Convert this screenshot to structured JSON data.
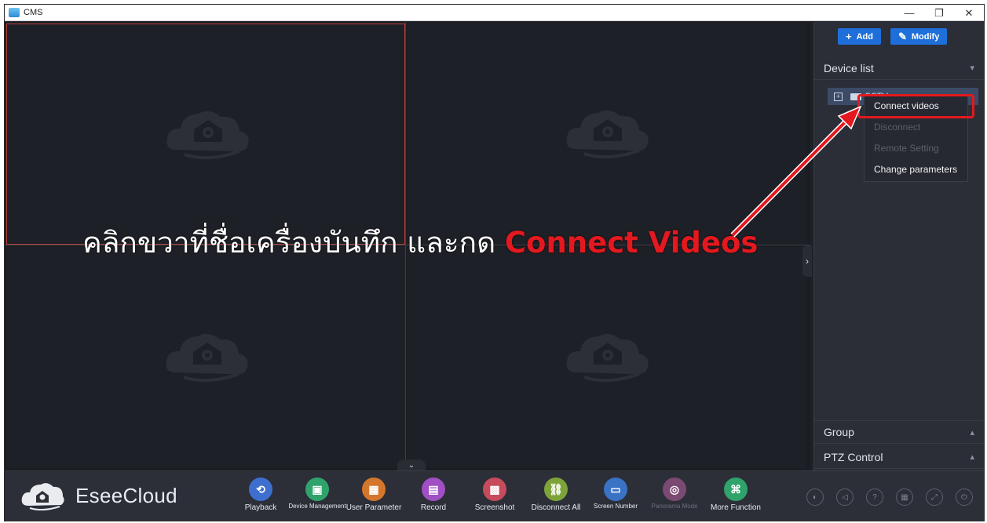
{
  "window": {
    "title": "CMS",
    "controls": [
      "—",
      "❐",
      "✕"
    ]
  },
  "right_panel": {
    "add_label": "Add",
    "modify_label": "Modify",
    "device_list_label": "Device list",
    "device_name": "CCTV",
    "group_label": "Group",
    "ptz_label": "PTZ Control"
  },
  "context_menu": {
    "items": [
      {
        "label": "Connect videos",
        "enabled": true
      },
      {
        "label": "Disconnect",
        "enabled": false
      },
      {
        "label": "Remote Setting",
        "enabled": false
      },
      {
        "label": "Change parameters",
        "enabled": true
      }
    ]
  },
  "toolbar": {
    "brand": "EseeCloud",
    "tools": [
      {
        "label": "Playback",
        "color": "#3e6fcf",
        "icon": "playback-icon",
        "glyph": "⟲"
      },
      {
        "label": "Device Management",
        "color": "#2fa36b",
        "icon": "device-management-icon",
        "glyph": "▣"
      },
      {
        "label": "User Parameter",
        "color": "#d4762c",
        "icon": "user-parameter-icon",
        "glyph": "▦"
      },
      {
        "label": "Record",
        "color": "#a04fc4",
        "icon": "record-icon",
        "glyph": "▤"
      },
      {
        "label": "Screenshot",
        "color": "#c64b5d",
        "icon": "screenshot-icon",
        "glyph": "▩"
      },
      {
        "label": "Disconnect All",
        "color": "#7da33a",
        "icon": "disconnect-all-icon",
        "glyph": "⛓"
      },
      {
        "label": "Screen Number",
        "color": "#3a72c4",
        "icon": "screen-number-icon",
        "glyph": "▭"
      },
      {
        "label": "Panorama Mode",
        "color": "#7b4a72",
        "icon": "panorama-mode-icon",
        "glyph": "◎"
      },
      {
        "label": "More Function",
        "color": "#2fa36b",
        "icon": "more-function-icon",
        "glyph": "⌘"
      }
    ]
  },
  "annotation": {
    "text": "คลิกขวาที่ชื่อเครื่องบันทึก และกด",
    "highlight": "Connect Videos",
    "color": "#e3191f"
  },
  "colors": {
    "accent_blue": "#1e6fd9",
    "background": "#1f2128",
    "panel": "#2b2e37"
  }
}
